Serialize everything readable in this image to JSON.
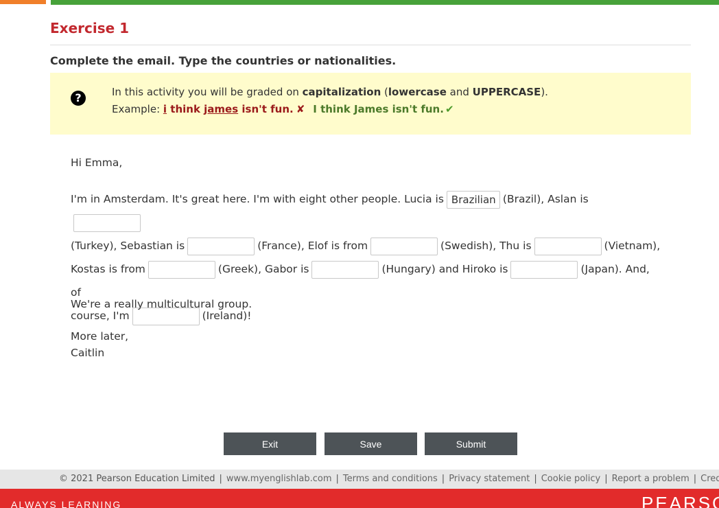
{
  "header": {
    "title": "Exercise 1"
  },
  "instructions": "Complete the email. Type the countries or nationalities.",
  "notice": {
    "help_icon": "?",
    "line1_prefix": "In this activity you will be graded on ",
    "line1_bold1": "capitalization",
    "line1_mid1": " (",
    "line1_bold2": "lowercase",
    "line1_mid2": " and ",
    "line1_bold3": "UPPERCASE",
    "line1_suffix": ").",
    "example_label": "Example: ",
    "wrong_i": "i",
    "wrong_mid": " think ",
    "wrong_james": "james",
    "wrong_end": " isn't fun.",
    "wrong_mark": "✘",
    "right_example": "I think James isn't fun.",
    "right_mark": "✔"
  },
  "email": {
    "greeting": "Hi Emma,",
    "t1": "I'm in Amsterdam. It's great here. I'm with eight other people. Lucia is",
    "b1": "Brazilian",
    "t2": "(Brazil), Aslan is",
    "b2": "",
    "t3": "(Turkey), Sebastian is",
    "b3": "",
    "t4": "(France), Elof is from",
    "b4": "",
    "t5": "(Swedish), Thu is",
    "b5": "",
    "t6": "(Vietnam),",
    "t7": "Kostas is from",
    "b6": "",
    "t8": "(Greek), Gabor is",
    "b7": "",
    "t9": "(Hungary) and Hiroko is",
    "b8": "",
    "t10": "(Japan). And, of",
    "t11": "course, I'm",
    "b9": "",
    "t12": "(Ireland)!",
    "line_a": "We're a really multicultural group.",
    "line_b": "More later,",
    "line_c": "Caitlin"
  },
  "buttons": {
    "exit": "Exit",
    "save": "Save",
    "submit": "Submit"
  },
  "footer": {
    "copyright": "© 2021 Pearson Education Limited",
    "site": "www.myenglishlab.com",
    "terms": "Terms and conditions",
    "privacy": "Privacy statement",
    "cookie": "Cookie policy",
    "report": "Report a problem",
    "credits": "Credits",
    "sep": "|"
  },
  "brand": {
    "tagline": "ALWAYS LEARNING",
    "logo_text": "PEARSON"
  },
  "colors": {
    "accent_orange": "#f07f2a",
    "accent_green": "#47a23a",
    "title_red": "#c2282e",
    "notice_bg": "#fffccc",
    "brand_red": "#e22b2b",
    "button_bg": "#4d5357"
  }
}
